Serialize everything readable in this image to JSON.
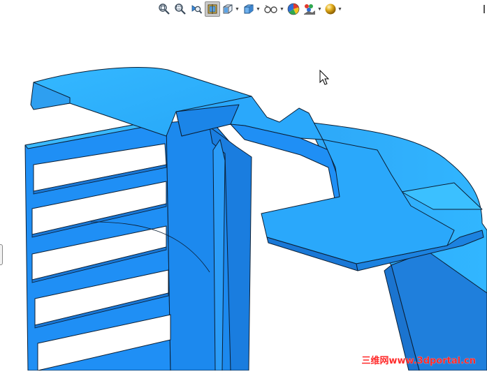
{
  "toolbar": {
    "tools": [
      {
        "name": "zoom-to-fit-icon",
        "caret": false
      },
      {
        "name": "zoom-to-area-icon",
        "caret": false
      },
      {
        "name": "previous-view-icon",
        "caret": false
      },
      {
        "name": "section-view-icon",
        "caret": false,
        "active": true
      },
      {
        "name": "view-orientation-icon",
        "caret": true
      },
      {
        "name": "display-style-icon",
        "caret": true
      },
      {
        "name": "hide-show-items-icon",
        "caret": true
      },
      {
        "name": "edit-appearance-icon",
        "caret": false
      },
      {
        "name": "apply-scene-icon",
        "caret": true
      },
      {
        "name": "view-settings-icon",
        "caret": true
      }
    ]
  },
  "viewport": {
    "part_color": "#1f8ff5",
    "edge_color": "#0b1e33"
  },
  "watermark": {
    "text": "三维网www.3dportal.cn",
    "color": "#ff2b2b"
  }
}
